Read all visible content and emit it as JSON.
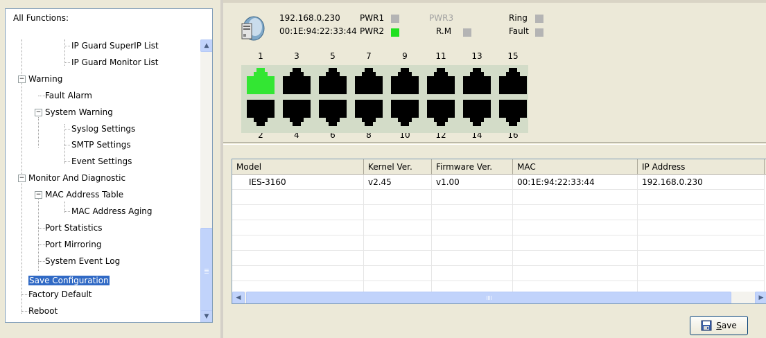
{
  "tree": {
    "title": "All Functions:",
    "items": [
      {
        "label": "IP Guard SuperIP List",
        "selected": false
      },
      {
        "label": "IP Guard Monitor List",
        "selected": false
      },
      {
        "label": "Warning",
        "selected": false
      },
      {
        "label": "Fault Alarm",
        "selected": false
      },
      {
        "label": "System Warning",
        "selected": false
      },
      {
        "label": "Syslog Settings",
        "selected": false
      },
      {
        "label": "SMTP Settings",
        "selected": false
      },
      {
        "label": "Event Settings",
        "selected": false
      },
      {
        "label": "Monitor And Diagnostic",
        "selected": false
      },
      {
        "label": "MAC Address Table",
        "selected": false
      },
      {
        "label": "MAC Address Aging",
        "selected": false
      },
      {
        "label": "Port Statistics",
        "selected": false
      },
      {
        "label": "Port Mirroring",
        "selected": false
      },
      {
        "label": "System Event Log",
        "selected": false
      },
      {
        "label": "Save Configuration",
        "selected": true
      },
      {
        "label": "Factory Default",
        "selected": false
      },
      {
        "label": "Reboot",
        "selected": false
      }
    ],
    "expander_minus": "−"
  },
  "device": {
    "ip": "192.168.0.230",
    "mac": "00:1E:94:22:33:44",
    "pwr1": "PWR1",
    "pwr2": "PWR2",
    "pwr3": "PWR3",
    "rm": "R.M",
    "ring": "Ring",
    "fault": "Fault",
    "colors": {
      "on": "#1fe01f",
      "off": "#b4b4b4",
      "port_active": "#33e633",
      "port_idle": "#000000"
    },
    "top_ports": [
      "1",
      "3",
      "5",
      "7",
      "9",
      "11",
      "13",
      "15"
    ],
    "bottom_ports": [
      "2",
      "4",
      "6",
      "8",
      "10",
      "12",
      "14",
      "16"
    ],
    "active_port": "1"
  },
  "table": {
    "headers": [
      "Model",
      "Kernel Ver.",
      "Firmware Ver.",
      "MAC",
      "IP Address"
    ],
    "rows": [
      [
        "IES-3160",
        "v2.45",
        "v1.00",
        "00:1E:94:22:33:44",
        "192.168.0.230"
      ]
    ]
  },
  "save_button": {
    "prefix": "",
    "underline": "S",
    "rest": "ave"
  },
  "icons": {
    "up": "▲",
    "down": "▼",
    "left": "◀",
    "right": "▶"
  }
}
